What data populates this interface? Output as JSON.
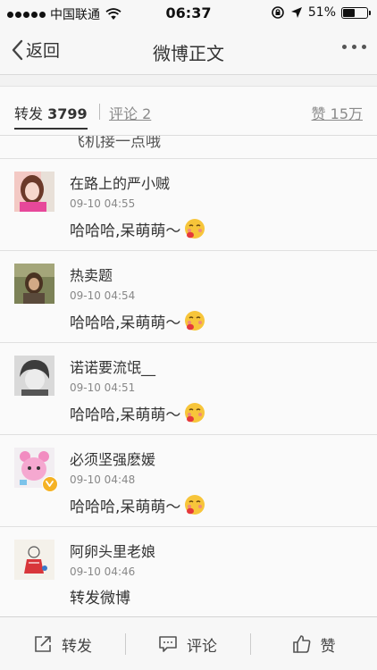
{
  "status_bar": {
    "carrier": "中国联通",
    "time": "06:37",
    "battery_percent": "51%",
    "battery_level": 0.51
  },
  "nav": {
    "back_label": "返回",
    "title": "微博正文"
  },
  "tabs": {
    "repost_label": "转发",
    "repost_count": "3799",
    "comment_label": "评论 2",
    "like_label": "赞 15万"
  },
  "partial_row_text": "飞机接一点哦",
  "reposts": [
    {
      "user": "在路上的严小贼",
      "time": "09-10 04:55",
      "text": "哈哈哈,呆萌萌～"
    },
    {
      "user": "热卖题",
      "time": "09-10 04:54",
      "text": "哈哈哈,呆萌萌～"
    },
    {
      "user": "诺诺要流氓__",
      "time": "09-10 04:51",
      "text": "哈哈哈,呆萌萌～"
    },
    {
      "user": "必须坚强麽媛",
      "time": "09-10 04:48",
      "text": "哈哈哈,呆萌萌～"
    },
    {
      "user": "阿卵头里老娘",
      "time": "09-10 04:46",
      "text": "转发微博"
    }
  ],
  "toolbar": {
    "repost_label": "转发",
    "comment_label": "评论",
    "like_label": "赞"
  }
}
